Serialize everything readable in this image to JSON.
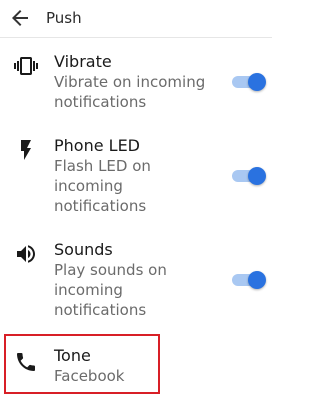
{
  "header": {
    "title": "Push",
    "back_icon": "arrow-left-icon"
  },
  "settings": [
    {
      "icon": "vibrate-icon",
      "title": "Vibrate",
      "subtitle": "Vibrate on incoming\nnotifications",
      "enabled": true
    },
    {
      "icon": "flash-icon",
      "title": "Phone LED",
      "subtitle": "Flash LED on\nincoming\nnotifications",
      "enabled": true
    },
    {
      "icon": "volume-icon",
      "title": "Sounds",
      "subtitle": "Play sounds on\nincoming\nnotifications",
      "enabled": true
    },
    {
      "icon": "phone-icon",
      "title": "Tone",
      "subtitle": "Facebook"
    }
  ],
  "colors": {
    "toggle_on": "#2a72e0",
    "toggle_track": "#a9c8f2",
    "highlight": "#d81f26"
  }
}
